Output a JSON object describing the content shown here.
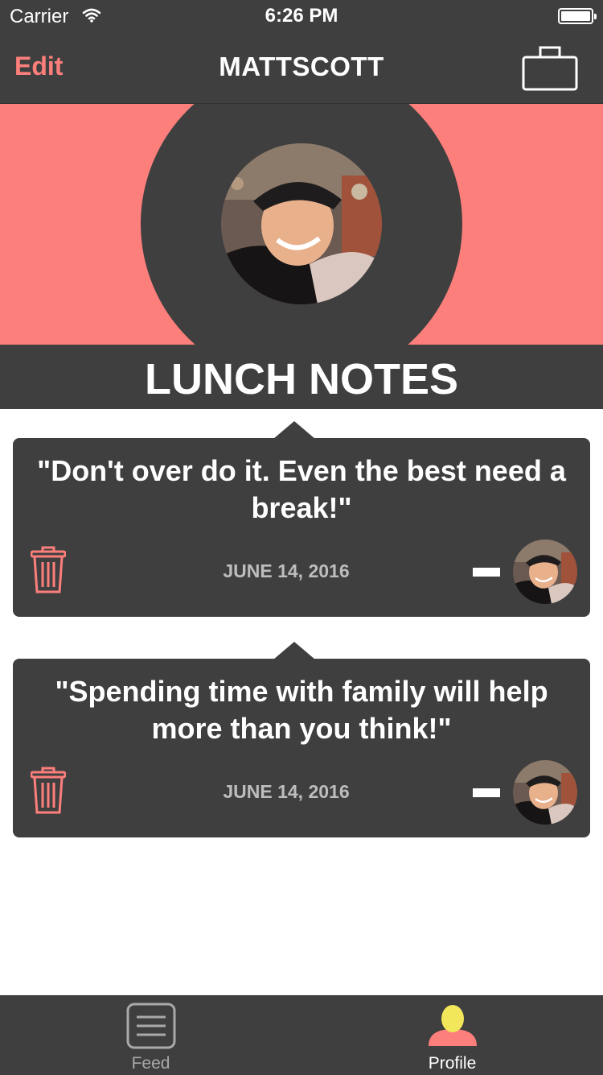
{
  "status": {
    "carrier": "Carrier",
    "time": "6:26 PM"
  },
  "nav": {
    "edit_label": "Edit",
    "title": "MATTSCOTT",
    "right_icon": "briefcase-icon"
  },
  "section": {
    "title": "LUNCH NOTES"
  },
  "notes": [
    {
      "quote": "\"Don't over do it. Even the best need a break!\"",
      "date": "JUNE 14, 2016"
    },
    {
      "quote": "\"Spending time with family will help more than you think!\"",
      "date": "JUNE 14, 2016"
    }
  ],
  "tabs": [
    {
      "label": "Feed",
      "icon": "list-icon",
      "selected": false
    },
    {
      "label": "Profile",
      "icon": "person-icon",
      "selected": true
    }
  ],
  "colors": {
    "accent": "#fd7f7c",
    "dark": "#3f3f3f",
    "profile_head": "#f2e65a"
  }
}
